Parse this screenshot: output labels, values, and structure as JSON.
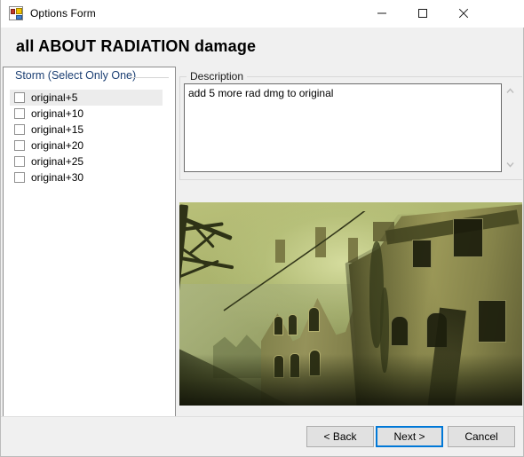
{
  "window": {
    "title": "Options Form",
    "icon": "windows-form-icon",
    "controls": {
      "minimize": "minimize-icon",
      "maximize": "maximize-icon",
      "close": "close-icon"
    }
  },
  "heading": "all ABOUT RADIATION damage",
  "storm_group": {
    "title": "Storm (Select Only One)",
    "options": [
      {
        "label": "original+5",
        "checked": false,
        "selected": true
      },
      {
        "label": "original+10",
        "checked": false,
        "selected": false
      },
      {
        "label": "original+15",
        "checked": false,
        "selected": false
      },
      {
        "label": "original+20",
        "checked": false,
        "selected": false
      },
      {
        "label": "original+25",
        "checked": false,
        "selected": false
      },
      {
        "label": "original+30",
        "checked": false,
        "selected": false
      }
    ]
  },
  "description_group": {
    "title": "Description",
    "text": "add 5 more rad dmg to original",
    "placeholder": "",
    "scrollbar": {
      "up": "chevron-up-icon",
      "down": "chevron-down-icon"
    }
  },
  "preview": {
    "alt": "dark green irradiated gothic mansion screenshot"
  },
  "buttons": {
    "back": "< Back",
    "next": "Next >",
    "cancel": "Cancel",
    "focused": "next"
  },
  "colors": {
    "group_title": "#1b3f73",
    "focus_border": "#0078d7",
    "window_bg": "#f0f0f0",
    "panel_bg": "#ffffff",
    "selected_row": "#ececec"
  }
}
